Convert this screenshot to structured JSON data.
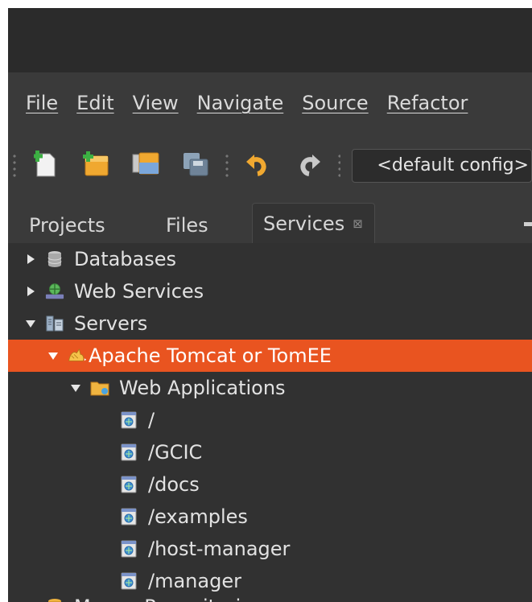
{
  "menubar": {
    "items": [
      "File",
      "Edit",
      "View",
      "Navigate",
      "Source",
      "Refactor"
    ]
  },
  "toolbar": {
    "buttons": [
      "new-file-icon",
      "new-project-icon",
      "open-project-icon",
      "save-all-icon",
      "undo-icon",
      "redo-icon"
    ],
    "config_value": "<default config>"
  },
  "tabs": {
    "projects": "Projects",
    "files": "Files",
    "services": "Services",
    "close_glyph": "⊠"
  },
  "tree": {
    "databases": "Databases",
    "web_services": "Web Services",
    "servers": "Servers",
    "tomcat": "Apache Tomcat or TomEE",
    "web_applications": "Web Applications",
    "apps": [
      "/",
      "/GCIC",
      "/docs",
      "/examples",
      "/host-manager",
      "/manager"
    ],
    "partial_next": "Maven Repositories"
  },
  "colors": {
    "selection": "#e95420",
    "background": "#313131",
    "bar": "#3a3a3a"
  }
}
